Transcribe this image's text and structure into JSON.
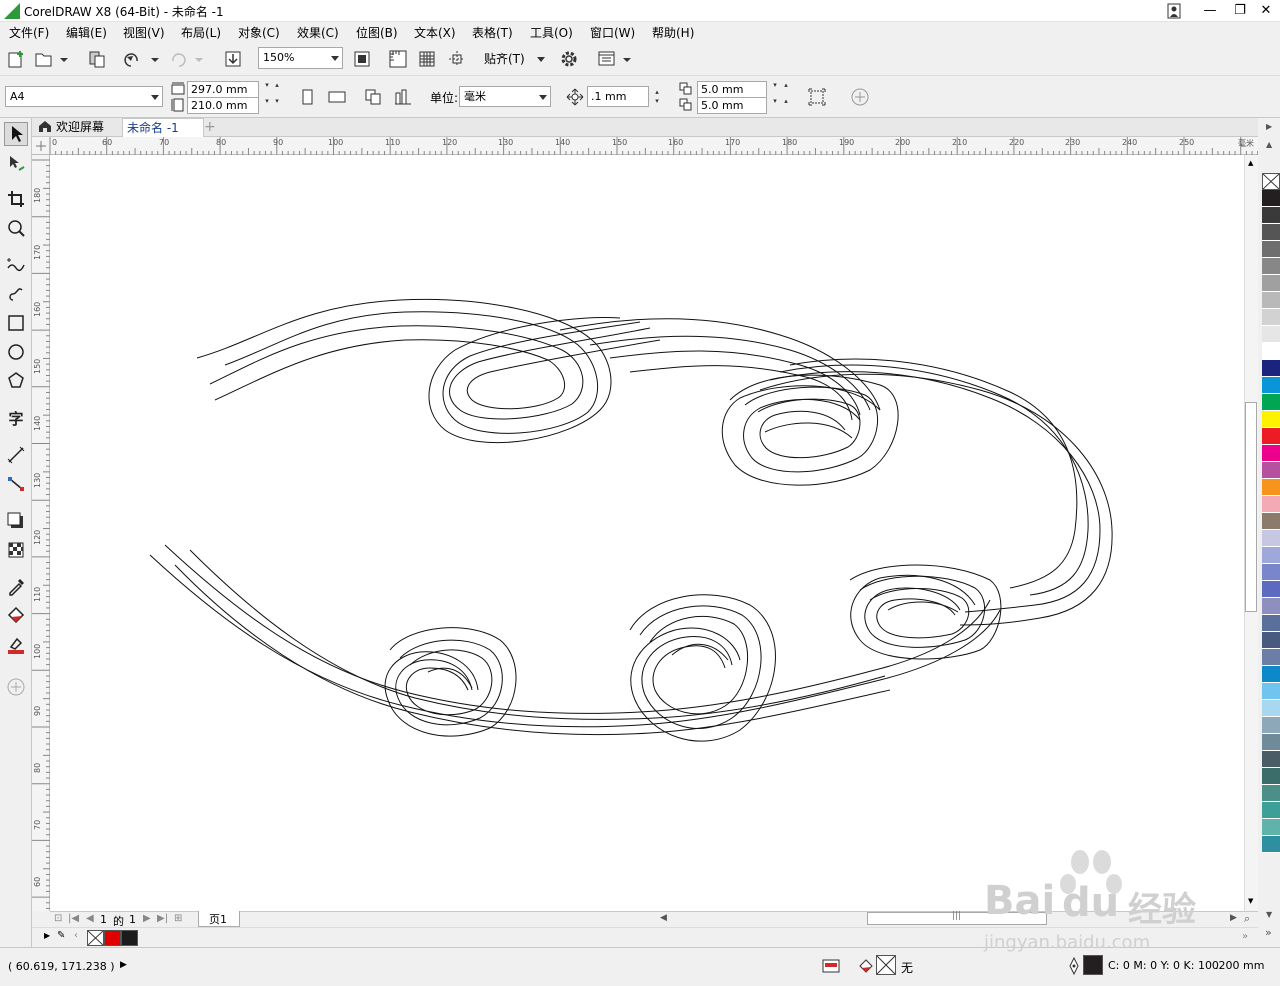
{
  "window": {
    "title": "CorelDRAW X8 (64-Bit) - 未命名 -1",
    "controls": {
      "minimize": "—",
      "restore": "❐",
      "close": "✕"
    }
  },
  "menu": [
    "文件(F)",
    "编辑(E)",
    "视图(V)",
    "布局(L)",
    "对象(C)",
    "效果(C)",
    "位图(B)",
    "文本(X)",
    "表格(T)",
    "工具(O)",
    "窗口(W)",
    "帮助(H)"
  ],
  "toolbar": {
    "zoom": "150%",
    "snap_label": "贴齐(T)"
  },
  "property_bar": {
    "page_size": "A4",
    "width": "297.0 mm",
    "height": "210.0 mm",
    "units_label": "单位:",
    "units_value": "毫米",
    "nudge": ".1 mm",
    "dup_x": "5.0 mm",
    "dup_y": "5.0 mm"
  },
  "tabs": [
    {
      "label": "欢迎屏幕",
      "active": false
    },
    {
      "label": "未命名 -1",
      "active": true
    }
  ],
  "rulers": {
    "unit": "毫米",
    "horizontal_ticks": [
      "0",
      "60",
      "70",
      "80",
      "90",
      "100",
      "110",
      "120",
      "130",
      "140",
      "150",
      "160",
      "170",
      "180",
      "190",
      "200",
      "210",
      "220",
      "230",
      "240",
      "250"
    ],
    "vertical_ticks": [
      "180",
      "170",
      "160",
      "150",
      "140",
      "130",
      "120",
      "110",
      "100",
      "90",
      "80",
      "70",
      "60"
    ]
  },
  "page_nav": {
    "current": "1",
    "of_label": "的",
    "total": "1",
    "page_tab": "页1"
  },
  "status": {
    "coords": "( 60.619, 171.238 )",
    "fill_label": "无",
    "outline_color": "C: 0 M: 0 Y: 0 K: 100",
    "outline_width": ".200 mm"
  },
  "palette_colors": [
    "#ffffff",
    "#231f20",
    "#3a3a3a",
    "#555555",
    "#6e6e6e",
    "#878787",
    "#a0a0a0",
    "#b9b9b9",
    "#d2d2d2",
    "#e6e6e6",
    "#ffffff",
    "#1a237e",
    "#0b95d9",
    "#00a651",
    "#fff200",
    "#ed1c24",
    "#ec008c",
    "#b5519e",
    "#f7941d",
    "#f4aab4",
    "#8c7a6b",
    "#c7c7e3",
    "#9fa8da",
    "#7986cb",
    "#5c6bc0",
    "#8e8ebf",
    "#5b6f9b",
    "#495a80",
    "#6c7ea5",
    "#0d88c9",
    "#70c5ee",
    "#a8d8f0",
    "#8da8b8",
    "#6f8a99",
    "#4a5d66",
    "#3b6e6a",
    "#4b8f88",
    "#3c9f98",
    "#5fb3ab",
    "#2e8fa0"
  ],
  "doc_palette": [
    "none",
    "#e00000",
    "#1b1b1b"
  ],
  "watermark": {
    "brand": "Bai",
    "brand2": "经验",
    "url": "jingyan.baidu.com"
  }
}
